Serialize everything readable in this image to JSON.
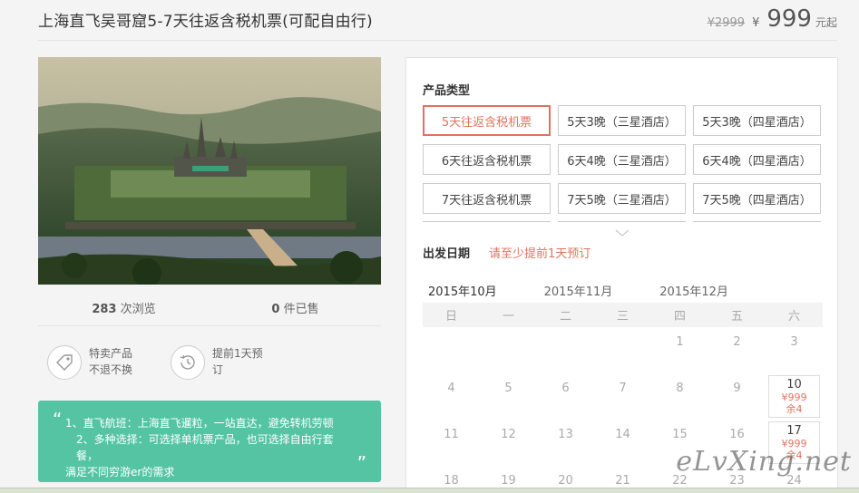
{
  "product": {
    "title": "上海直飞吴哥窟5-7天往返含税机票(可配自由行)",
    "old_price": "¥2999",
    "currency_symbol": "¥",
    "price": "999",
    "price_suffix": "元起"
  },
  "stats": {
    "views_count": "283",
    "views_label": "次浏览",
    "sold_count": "0",
    "sold_label": "件已售"
  },
  "badges": [
    {
      "icon": "tag-icon",
      "label": "特卖产品 不退不换"
    },
    {
      "icon": "clock-history-icon",
      "label": "提前1天预订"
    }
  ],
  "note": {
    "open_quote": "“",
    "close_quote": "”",
    "line1": "1、直飞航班：上海直飞暹粒，一站直达，避免转机劳顿",
    "line2": "2、多种选择：可选择单机票产品，也可选择自由行套餐，",
    "line3": "满足不同穷游er的需求"
  },
  "booking": {
    "product_type_title": "产品类型",
    "options": [
      "5天往返含税机票",
      "5天3晚（三星酒店）",
      "5天3晚（四星酒店）",
      "6天往返含税机票",
      "6天4晚（三星酒店）",
      "6天4晚（四星酒店）",
      "7天往返含税机票",
      "7天5晚（三星酒店）",
      "7天5晚（四星酒店）"
    ],
    "selected_option": "5天往返含税机票",
    "date_title": "出发日期",
    "date_hint": "请至少提前1天预订",
    "months": [
      "2015年10月",
      "2015年11月",
      "2015年12月"
    ],
    "active_month": "2015年10月",
    "weekdays": [
      "日",
      "一",
      "二",
      "三",
      "四",
      "五",
      "六"
    ],
    "calendar_rows": [
      [
        {
          "d": ""
        },
        {
          "d": ""
        },
        {
          "d": ""
        },
        {
          "d": ""
        },
        {
          "d": "1"
        },
        {
          "d": "2"
        },
        {
          "d": "3"
        }
      ],
      [
        {
          "d": "4"
        },
        {
          "d": "5"
        },
        {
          "d": "6"
        },
        {
          "d": "7"
        },
        {
          "d": "8"
        },
        {
          "d": "9"
        },
        {
          "d": "10",
          "price": "¥999",
          "remain": "余4"
        }
      ],
      [
        {
          "d": "11"
        },
        {
          "d": "12"
        },
        {
          "d": "13"
        },
        {
          "d": "14"
        },
        {
          "d": "15"
        },
        {
          "d": "16"
        },
        {
          "d": "17",
          "price": "¥999",
          "remain": "余4"
        }
      ],
      [
        {
          "d": "18"
        },
        {
          "d": "19"
        },
        {
          "d": "20"
        },
        {
          "d": "21"
        },
        {
          "d": "22"
        },
        {
          "d": "23"
        },
        {
          "d": "24"
        }
      ]
    ]
  },
  "watermark": "eLvXing.net",
  "colors": {
    "accent": "#e0735f",
    "note_bg": "#55c4a3"
  }
}
